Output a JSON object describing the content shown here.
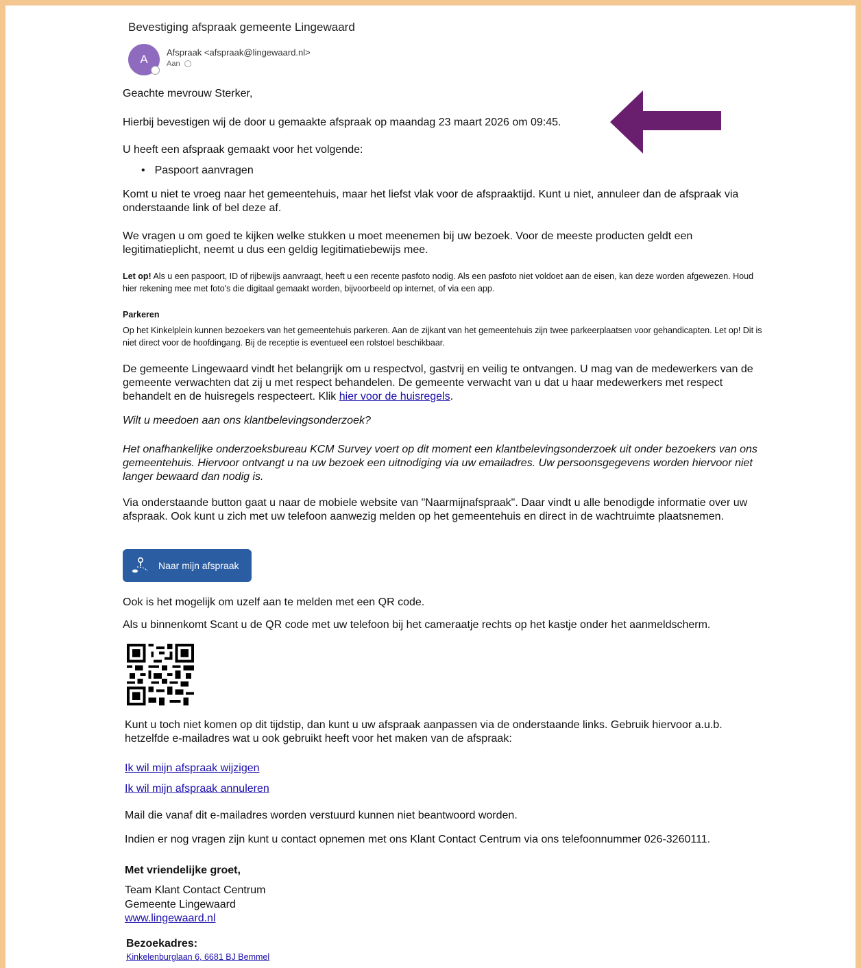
{
  "email": {
    "subject": "Bevestiging afspraak gemeente Lingewaard",
    "avatar_letter": "A",
    "sender": "Afspraak <afspraak@lingewaard.nl>",
    "to_label": "Aan"
  },
  "body": {
    "greeting": "Geachte mevrouw Sterker,",
    "confirmation": "Hierbij bevestigen wij de door u gemaakte afspraak op maandag 23 maart 2026 om 09:45.",
    "intro": "U heeft een afspraak gemaakt voor het volgende:",
    "items": [
      "Paspoort aanvragen"
    ],
    "timing": "Komt u niet te vroeg naar het gemeentehuis, maar het liefst vlak voor de afspraaktijd. Kunt u niet, annuleer dan de afspraak via onderstaande link of bel deze af.",
    "documents": "We vragen u om goed te kijken welke stukken u moet meenemen bij uw bezoek. Voor de meeste producten geldt een legitimatieplicht, neemt u dus een geldig legitimatiebewijs mee.",
    "notice_label": "Let op!",
    "notice_text": " Als u een paspoort, ID of rijbewijs aanvraagt, heeft u een recente pasfoto nodig. Als een pasfoto niet voldoet aan de eisen, kan deze worden afgewezen. Houd hier rekening mee met foto's die digitaal gemaakt worden, bijvoorbeeld op internet, of via een app.",
    "parking_title": "Parkeren",
    "parking_text": "Op het Kinkelplein kunnen bezoekers van het gemeentehuis parkeren. Aan de zijkant van het gemeentehuis zijn twee parkeerplaatsen voor gehandicapten. Let op! Dit is niet direct voor de hoofdingang. Bij de receptie is eventueel een rolstoel beschikbaar.",
    "respect_text": "De gemeente Lingewaard vindt het belangrijk om u respectvol, gastvrij en veilig te ontvangen. U mag van de medewerkers van de gemeente verwachten dat zij u met respect behandelen. De gemeente verwacht van u dat u haar medewerkers met respect behandelt en de huisregels respecteert. Klik ",
    "house_rules_link": "hier voor de huisregels",
    "respect_end": ".",
    "survey_question": "Wilt u meedoen aan ons klantbelevingsonderzoek?",
    "survey_text": "Het onafhankelijke onderzoeksbureau KCM Survey voert op dit moment een klantbelevingsonderzoek uit onder bezoekers van ons gemeentehuis. Hiervoor ontvangt u na uw bezoek een uitnodiging via uw emailadres. Uw persoonsgegevens worden hiervoor niet langer bewaard dan nodig is.",
    "button_intro": "Via onderstaande button gaat u naar de mobiele website van \"Naarmijnafspraak\". Daar vindt u alle benodigde informatie over uw afspraak. Ook kunt u zich met uw telefoon aanwezig melden op het gemeentehuis en direct in de wachtruimte plaatsnemen.",
    "button_label": "Naar mijn afspraak",
    "qr_intro": "Ook is het mogelijk om uzelf aan te melden met een QR code.",
    "qr_instruction": "Als u binnenkomt Scant u de QR code met uw telefoon bij het cameraatje rechts op het kastje onder het aanmeldscherm.",
    "change_text": "Kunt u toch niet komen op dit tijdstip, dan kunt u uw afspraak aanpassen via de onderstaande links. Gebruik hiervoor a.u.b. hetzelfde e-mailadres wat u ook gebruikt heeft voor het maken van de afspraak:",
    "change_link": "Ik wil mijn afspraak wijzigen",
    "cancel_link": "Ik wil mijn afspraak annuleren",
    "no_reply": "Mail die vanaf dit e-mailadres worden verstuurd kunnen niet beantwoord worden.",
    "contact": "Indien er nog vragen zijn kunt u contact opnemen met ons Klant Contact Centrum via ons telefoonnummer 026-3260111.",
    "closing": "Met vriendelijke groet,",
    "team": "Team Klant Contact Centrum",
    "org": "Gemeente Lingewaard",
    "website": "www.lingewaard.nl",
    "address_label": "Bezoekadres:",
    "address": "Kinkelenburglaan 6, 6681 BJ Bemmel"
  },
  "colors": {
    "frame": "#f3c78f",
    "arrow": "#6a1f6e",
    "button": "#2b5da3",
    "avatar": "#8e6bbf",
    "link": "#1a0dab"
  },
  "icons": {
    "button_icon": "location-route-icon",
    "annotation": "arrow-left-icon"
  }
}
